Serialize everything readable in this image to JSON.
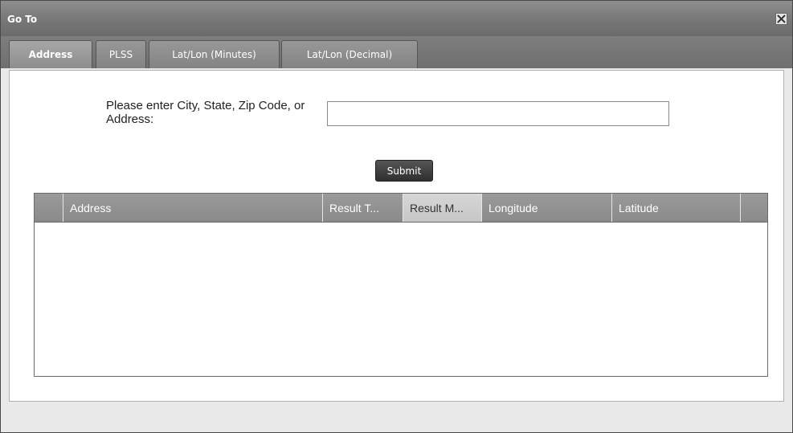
{
  "window": {
    "title": "Go To",
    "close_icon": "close-x-icon"
  },
  "tabs": [
    {
      "label": "Address",
      "active": true
    },
    {
      "label": "PLSS",
      "active": false
    },
    {
      "label": "Lat/Lon (Minutes)",
      "active": false
    },
    {
      "label": "Lat/Lon (Decimal)",
      "active": false
    }
  ],
  "form": {
    "prompt_label": "Please enter City, State, Zip Code, or Address:",
    "address_value": "",
    "address_placeholder": "",
    "submit_label": "Submit"
  },
  "results_grid": {
    "columns": [
      "",
      "Address",
      "Result T...",
      "Result M...",
      "Longitude",
      "Latitude",
      ""
    ],
    "sorted_column": "Result M...",
    "rows": []
  },
  "colors": {
    "titlebar": "#7a7a7a",
    "tabstrip": "#6f6f6f",
    "header": "#8a8a8a",
    "accent_sorted_header": "#c6c6c6",
    "submit_button": "#2f2f2f"
  }
}
